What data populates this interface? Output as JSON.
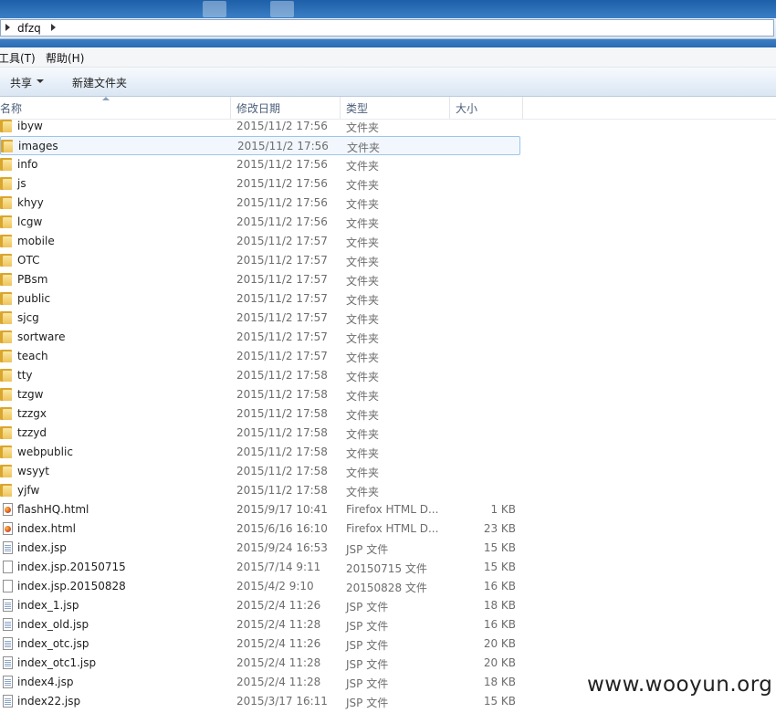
{
  "address": {
    "path": "dfzq"
  },
  "menu": {
    "tools": "工具(T)",
    "help": "帮助(H)"
  },
  "toolbar": {
    "share": "共享",
    "new_folder": "新建文件夹"
  },
  "columns": {
    "name": "名称",
    "date": "修改日期",
    "type": "类型",
    "size": "大小"
  },
  "files": [
    {
      "name": "ibyw",
      "date": "2015/11/2 17:56",
      "type": "文件夹",
      "size": "",
      "kind": "folder"
    },
    {
      "name": "images",
      "date": "2015/11/2 17:56",
      "type": "文件夹",
      "size": "",
      "kind": "folder",
      "hovered": true
    },
    {
      "name": "info",
      "date": "2015/11/2 17:56",
      "type": "文件夹",
      "size": "",
      "kind": "folder"
    },
    {
      "name": "js",
      "date": "2015/11/2 17:56",
      "type": "文件夹",
      "size": "",
      "kind": "folder"
    },
    {
      "name": "khyy",
      "date": "2015/11/2 17:56",
      "type": "文件夹",
      "size": "",
      "kind": "folder"
    },
    {
      "name": "lcgw",
      "date": "2015/11/2 17:56",
      "type": "文件夹",
      "size": "",
      "kind": "folder"
    },
    {
      "name": "mobile",
      "date": "2015/11/2 17:57",
      "type": "文件夹",
      "size": "",
      "kind": "folder"
    },
    {
      "name": "OTC",
      "date": "2015/11/2 17:57",
      "type": "文件夹",
      "size": "",
      "kind": "folder"
    },
    {
      "name": "PBsm",
      "date": "2015/11/2 17:57",
      "type": "文件夹",
      "size": "",
      "kind": "folder"
    },
    {
      "name": "public",
      "date": "2015/11/2 17:57",
      "type": "文件夹",
      "size": "",
      "kind": "folder"
    },
    {
      "name": "sjcg",
      "date": "2015/11/2 17:57",
      "type": "文件夹",
      "size": "",
      "kind": "folder"
    },
    {
      "name": "sortware",
      "date": "2015/11/2 17:57",
      "type": "文件夹",
      "size": "",
      "kind": "folder"
    },
    {
      "name": "teach",
      "date": "2015/11/2 17:57",
      "type": "文件夹",
      "size": "",
      "kind": "folder"
    },
    {
      "name": "tty",
      "date": "2015/11/2 17:58",
      "type": "文件夹",
      "size": "",
      "kind": "folder"
    },
    {
      "name": "tzgw",
      "date": "2015/11/2 17:58",
      "type": "文件夹",
      "size": "",
      "kind": "folder"
    },
    {
      "name": "tzzgx",
      "date": "2015/11/2 17:58",
      "type": "文件夹",
      "size": "",
      "kind": "folder"
    },
    {
      "name": "tzzyd",
      "date": "2015/11/2 17:58",
      "type": "文件夹",
      "size": "",
      "kind": "folder"
    },
    {
      "name": "webpublic",
      "date": "2015/11/2 17:58",
      "type": "文件夹",
      "size": "",
      "kind": "folder"
    },
    {
      "name": "wsyyt",
      "date": "2015/11/2 17:58",
      "type": "文件夹",
      "size": "",
      "kind": "folder"
    },
    {
      "name": "yjfw",
      "date": "2015/11/2 17:58",
      "type": "文件夹",
      "size": "",
      "kind": "folder"
    },
    {
      "name": "flashHQ.html",
      "date": "2015/9/17 10:41",
      "type": "Firefox HTML D...",
      "size": "1 KB",
      "kind": "html"
    },
    {
      "name": "index.html",
      "date": "2015/6/16 16:10",
      "type": "Firefox HTML D...",
      "size": "23 KB",
      "kind": "html"
    },
    {
      "name": "index.jsp",
      "date": "2015/9/24 16:53",
      "type": "JSP 文件",
      "size": "15 KB",
      "kind": "jsp"
    },
    {
      "name": "index.jsp.20150715",
      "date": "2015/7/14 9:11",
      "type": "20150715 文件",
      "size": "15 KB",
      "kind": "file"
    },
    {
      "name": "index.jsp.20150828",
      "date": "2015/4/2 9:10",
      "type": "20150828 文件",
      "size": "16 KB",
      "kind": "file"
    },
    {
      "name": "index_1.jsp",
      "date": "2015/2/4 11:26",
      "type": "JSP 文件",
      "size": "18 KB",
      "kind": "jsp"
    },
    {
      "name": "index_old.jsp",
      "date": "2015/2/4 11:28",
      "type": "JSP 文件",
      "size": "16 KB",
      "kind": "jsp"
    },
    {
      "name": "index_otc.jsp",
      "date": "2015/2/4 11:26",
      "type": "JSP 文件",
      "size": "20 KB",
      "kind": "jsp"
    },
    {
      "name": "index_otc1.jsp",
      "date": "2015/2/4 11:28",
      "type": "JSP 文件",
      "size": "20 KB",
      "kind": "jsp"
    },
    {
      "name": "index4.jsp",
      "date": "2015/2/4 11:28",
      "type": "JSP 文件",
      "size": "18 KB",
      "kind": "jsp"
    },
    {
      "name": "index22.jsp",
      "date": "2015/3/17 16:11",
      "type": "JSP 文件",
      "size": "15 KB",
      "kind": "jsp"
    }
  ],
  "watermark": "www.wooyun.org"
}
